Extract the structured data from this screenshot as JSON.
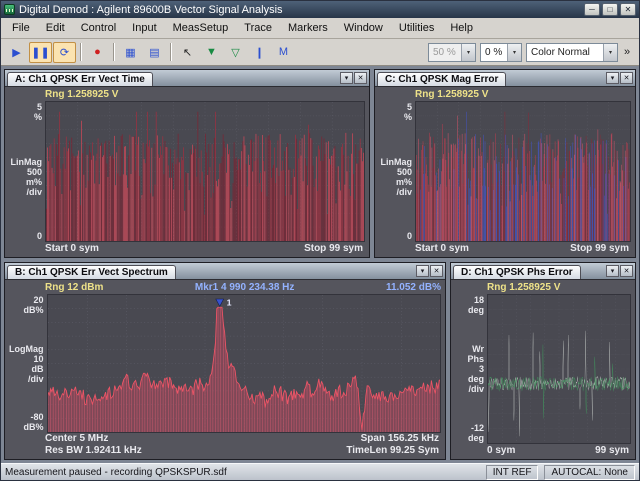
{
  "window": {
    "title": "Digital Demod : Agilent 89600B Vector Signal Analysis",
    "controls": {
      "minimize": "─",
      "maximize": "□",
      "close": "✕"
    }
  },
  "icons": {
    "dropdown": "▾",
    "close": "✕",
    "overflow": "»"
  },
  "menu": {
    "items": [
      "File",
      "Edit",
      "Control",
      "Input",
      "MeasSetup",
      "Trace",
      "Markers",
      "Window",
      "Utilities",
      "Help"
    ]
  },
  "toolbar": {
    "buttons": [
      {
        "name": "play",
        "glyph": "▶"
      },
      {
        "name": "pause",
        "glyph": "❚❚"
      },
      {
        "name": "restart",
        "glyph": "⟳"
      },
      {
        "name": "record",
        "glyph": "●"
      },
      {
        "name": "layout",
        "glyph": "▦"
      },
      {
        "name": "display",
        "glyph": "▤"
      },
      {
        "name": "pointer",
        "glyph": "↖"
      },
      {
        "name": "peak-marker",
        "glyph": "▼"
      },
      {
        "name": "delta-marker",
        "glyph": "▽"
      },
      {
        "name": "band-marker",
        "glyph": "❙"
      },
      {
        "name": "offset-marker",
        "glyph": "M"
      }
    ],
    "combos": {
      "zoom": "50 %",
      "offset": "0 %",
      "color": "Color Normal"
    }
  },
  "panels": {
    "a": {
      "title": "A: Ch1 QPSK Err Vect Time",
      "range": "Rng 1.258925  V",
      "y_top": [
        "5",
        "%"
      ],
      "y_mid": [
        "LinMag",
        "500",
        "m%",
        "/div"
      ],
      "y_bottom": [
        "0"
      ],
      "x_left": "Start 0  sym",
      "x_right": "Stop 99  sym"
    },
    "c": {
      "title": "C: Ch1 QPSK Mag Error",
      "range": "Rng 1.258925  V",
      "y_top": [
        "5",
        "%"
      ],
      "y_mid": [
        "LinMag",
        "500",
        "m%",
        "/div"
      ],
      "y_bottom": [
        "0"
      ],
      "x_left": "Start 0  sym",
      "x_right": "Stop 99  sym"
    },
    "b": {
      "title": "B: Ch1 QPSK Err Vect Spectrum",
      "range": "Rng 12 dBm",
      "marker_readout": "Mkr1  4 990 234.38  Hz",
      "marker_level": "11.052 dB%",
      "y_top": [
        "20",
        "dB%"
      ],
      "y_mid": [
        "LogMag",
        "10",
        "dB",
        "/div"
      ],
      "y_bottom": [
        "-80",
        "dB%"
      ],
      "x_left1": "Center 5 MHz",
      "x_left2": "Res BW 1.92411 kHz",
      "x_right1": "Span 156.25 kHz",
      "x_right2": "TimeLen 99.25  Sym"
    },
    "d": {
      "title": "D: Ch1 QPSK Phs Error",
      "range": "Rng 1.258925  V",
      "y_top": [
        "18",
        "deg"
      ],
      "y_mid": [
        "Wr Phs",
        "3",
        "deg",
        "/div"
      ],
      "y_bottom": [
        "-12",
        "deg"
      ],
      "x_left": "0  sym",
      "x_right": "99  sym"
    }
  },
  "statusbar": {
    "message": "Measurement paused  - recording QPSKSPUR.sdf",
    "int_ref": "INT REF",
    "autocal": "AUTOCAL: None"
  },
  "chart_data": [
    {
      "id": "plot-a",
      "style": "comb",
      "type": "bar",
      "title": "Ch1 QPSK Err Vect Time",
      "ylabel": "LinMag (%)",
      "ylim": [
        0,
        5
      ],
      "per_div": "500 m%",
      "xlim": [
        0,
        99
      ],
      "xlabel": "sym",
      "range": "1.258925 V",
      "seed": 7,
      "colors": [
        "#a03040",
        "#d04858",
        "#7c2433"
      ],
      "description": "Error-vector magnitude vs symbol: dense noise-like comb of ~300 red bars rising from 0, mostly 1-4 % of full scale 5 %, 10x10 dotted grid"
    },
    {
      "id": "plot-c",
      "style": "comb",
      "type": "bar",
      "title": "Ch1 QPSK Mag Error",
      "ylabel": "LinMag (%)",
      "ylim": [
        0,
        5
      ],
      "per_div": "500 m%",
      "xlim": [
        0,
        99
      ],
      "xlabel": "sym",
      "range": "1.258925 V",
      "seed": 13,
      "colors": [
        "#c23c4e",
        "#4456c8",
        "#8c2838",
        "#d8546a"
      ],
      "description": "Magnitude error vs symbol: interleaved red and blue noise bars, mostly 1-4 % of full scale 5 %"
    },
    {
      "id": "plot-b",
      "style": "spectrum",
      "type": "area",
      "title": "Ch1 QPSK Err Vect Spectrum",
      "ylabel": "LogMag (dB)",
      "ylim": [
        -80,
        20
      ],
      "per_div": "10 dB",
      "center": "5 MHz",
      "span": "156.25 kHz",
      "res_bw": "1.92411 kHz",
      "time_len": "99.25 Sym",
      "marker": {
        "n": 1,
        "x_hz": 4990234.38,
        "y_db": 11.052
      },
      "peak_t": 0.4375,
      "seed": 21,
      "description": "Error-vector spectrum: jagged noise floor near -50 dB, dominant spur peaking at 11.052 dB slightly left of center (marker 1, 4.99023438 MHz), deep notch to ~-75 dB near 80 % of span, red filled trace"
    },
    {
      "id": "plot-d",
      "style": "phase",
      "type": "line",
      "title": "Ch1 QPSK Phs Error",
      "ylabel": "Wr Phs (deg)",
      "ylim": [
        -12,
        18
      ],
      "per_div": "3 deg",
      "xlim": [
        0,
        99
      ],
      "xlabel": "sym",
      "seed": 33,
      "colors": [
        "#d3d8d3",
        "#3fae62"
      ],
      "description": "Wrapped phase error vs symbol: two overlaid traces (white, green) with ±2 deg noise around 0 deg and sporadic ±10 deg spikes"
    }
  ]
}
